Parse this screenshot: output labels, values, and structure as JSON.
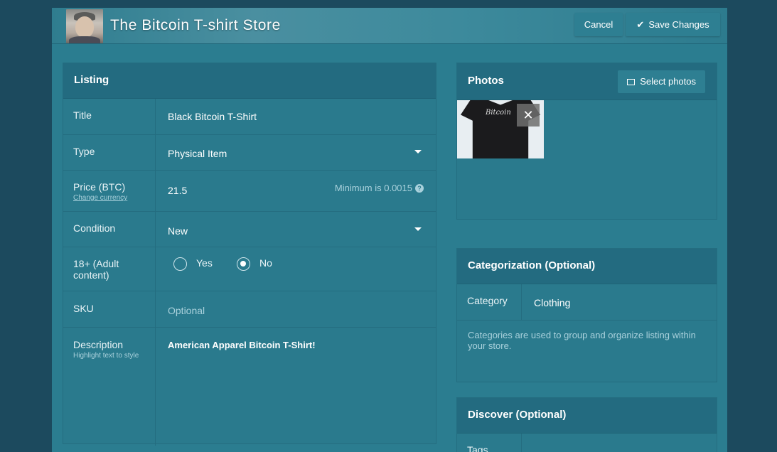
{
  "header": {
    "store_title": "The Bitcoin T-shirt Store",
    "cancel_label": "Cancel",
    "save_label": "Save Changes"
  },
  "listing": {
    "heading": "Listing",
    "title_label": "Title",
    "title_value": "Black Bitcoin T-Shirt",
    "type_label": "Type",
    "type_value": "Physical Item",
    "price_label": "Price (BTC)",
    "change_currency": "Change currency",
    "price_value": "21.5",
    "price_hint": "Minimum is 0.0015",
    "condition_label": "Condition",
    "condition_value": "New",
    "adult_label": "18+ (Adult content)",
    "adult_yes": "Yes",
    "adult_no": "No",
    "adult_selected": "No",
    "sku_label": "SKU",
    "sku_placeholder": "Optional",
    "description_label": "Description",
    "description_sub": "Highlight text to style",
    "description_value": "American Apparel Bitcoin T-Shirt!"
  },
  "photos": {
    "heading": "Photos",
    "select_label": "Select photos",
    "thumb_text": "Bitcoin"
  },
  "categorization": {
    "heading": "Categorization (Optional)",
    "category_label": "Category",
    "category_value": "Clothing",
    "note": "Categories are used to group and organize listing within your store."
  },
  "discover": {
    "heading": "Discover (Optional)",
    "tags_label": "Tags"
  }
}
